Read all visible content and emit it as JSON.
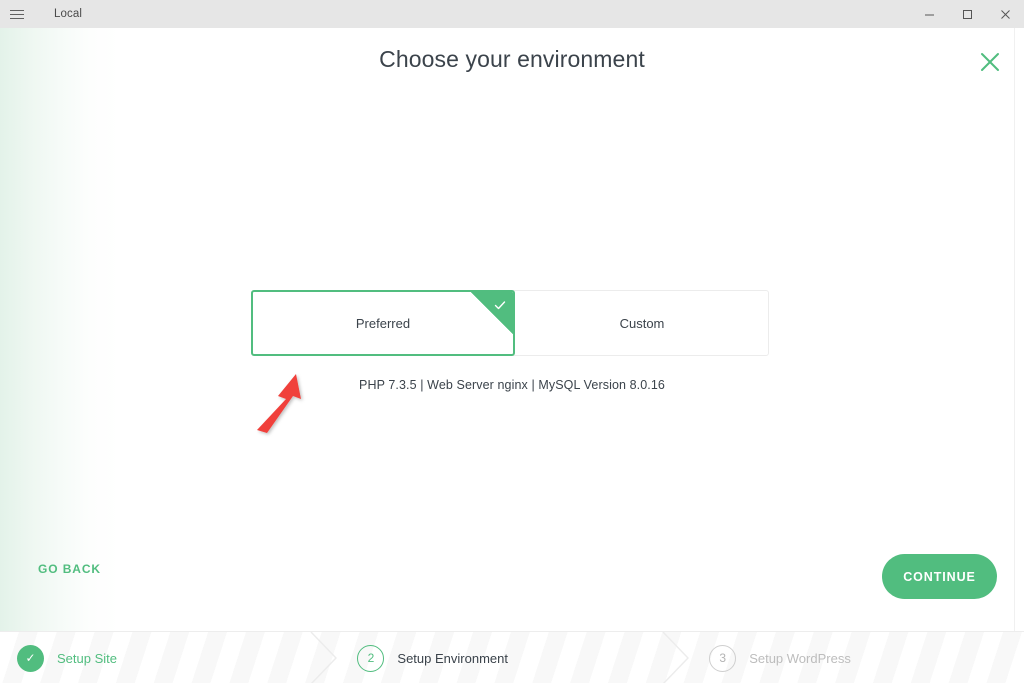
{
  "window": {
    "title": "Local",
    "menu_icon": "hamburger-menu-icon",
    "minimize_label": "Minimize",
    "maximize_label": "Maximize",
    "close_label": "Close"
  },
  "header": {
    "title": "Choose your environment",
    "close_icon": "close-icon"
  },
  "environment": {
    "options": [
      {
        "label": "Preferred",
        "selected": true
      },
      {
        "label": "Custom",
        "selected": false
      }
    ],
    "details": "PHP 7.3.5 | Web Server nginx | MySQL Version 8.0.16",
    "selected_badge_icon": "check-icon"
  },
  "footer": {
    "back_label": "GO BACK",
    "continue_label": "CONTINUE"
  },
  "steps": [
    {
      "marker": "✓",
      "label": "Setup Site",
      "state": "done"
    },
    {
      "marker": "2",
      "label": "Setup Environment",
      "state": "active"
    },
    {
      "marker": "3",
      "label": "Setup WordPress",
      "state": "todo"
    }
  ],
  "annotation": {
    "arrow_color": "#f0403a",
    "points_at": "Preferred"
  },
  "colors": {
    "accent_green": "#51bd7f",
    "text_dark": "#3b434b",
    "text_muted": "#bdbdbd",
    "titlebar_bg": "#e6e6e6"
  }
}
